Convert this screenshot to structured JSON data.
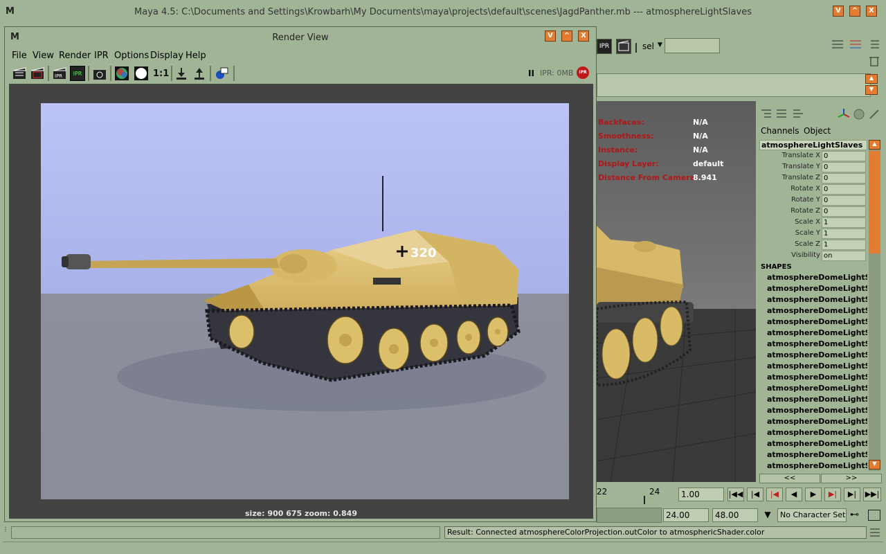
{
  "app": {
    "title": "Maya 4.5: C:\\Documents and Settings\\Krowbarh\\My Documents\\maya\\projects\\default\\scenes\\JagdPanther.mb   ---   atmosphereLightSlaves",
    "logo": "M",
    "window_buttons": [
      "V",
      "^",
      "X"
    ]
  },
  "shelf": {
    "sel_label": "sel",
    "icon_labels": [
      "IPR",
      "clapper"
    ]
  },
  "viewport_hud": [
    {
      "key": "Backfaces:",
      "value": "N/A"
    },
    {
      "key": "Smoothness:",
      "value": "N/A"
    },
    {
      "key": "Instance:",
      "value": "N/A"
    },
    {
      "key": "Display Layer:",
      "value": "default"
    },
    {
      "key": "Distance From Camera:",
      "value": "8.941"
    }
  ],
  "channel_box": {
    "tabs": [
      "Channels",
      "Object"
    ],
    "object": "atmosphereLightSlaves",
    "attributes": [
      {
        "name": "Translate X",
        "value": "0"
      },
      {
        "name": "Translate Y",
        "value": "0"
      },
      {
        "name": "Translate Z",
        "value": "0"
      },
      {
        "name": "Rotate X",
        "value": "0"
      },
      {
        "name": "Rotate Y",
        "value": "0"
      },
      {
        "name": "Rotate Z",
        "value": "0"
      },
      {
        "name": "Scale X",
        "value": "1"
      },
      {
        "name": "Scale Y",
        "value": "1"
      },
      {
        "name": "Scale Z",
        "value": "1"
      },
      {
        "name": "Visibility",
        "value": "on"
      }
    ],
    "shapes_header": "SHAPES",
    "shapes": [
      "atmosphereDomeLightSla",
      "atmosphereDomeLightSla",
      "atmosphereDomeLightSla",
      "atmosphereDomeLightSla",
      "atmosphereDomeLightSla",
      "atmosphereDomeLightSla",
      "atmosphereDomeLightSla",
      "atmosphereDomeLightSla",
      "atmosphereDomeLightSla",
      "atmosphereDomeLightSla",
      "atmosphereDomeLightSla",
      "atmosphereDomeLightSla",
      "atmosphereDomeLightSla",
      "atmosphereDomeLightSla",
      "atmosphereDomeLightSla",
      "atmosphereDomeLightSla",
      "atmosphereDomeLightSla",
      "atmosphereDomeLightSla"
    ],
    "nav_left": "<<",
    "nav_right": ">>"
  },
  "timeline": {
    "tick_22": "22",
    "tick_24": "24",
    "current_frame": "1.00",
    "range_end": "24.00",
    "anim_end": "48.00",
    "character_set": "No Character Set"
  },
  "render_view": {
    "title": "Render View",
    "menus": [
      "File",
      "View",
      "Render",
      "IPR",
      "Options",
      "Display",
      "Help"
    ],
    "toolbar_ratio": "1:1",
    "ipr_status": "IPR: 0MB",
    "ipr_badge": "IPR",
    "pause_icon": "II",
    "size_label": "size:  900  675 zoom: 0.849",
    "decal": "320"
  },
  "status": {
    "result": "Result: Connected atmosphereColorProjection.outColor to atmosphericShader.color"
  },
  "colors": {
    "window_bg": "#a2b496",
    "accent_orange": "#e37b31",
    "sky": "#bcc4f5",
    "ground": "#8a8e9c",
    "tank": "#e0c16e",
    "hud_key": "#b01818"
  }
}
